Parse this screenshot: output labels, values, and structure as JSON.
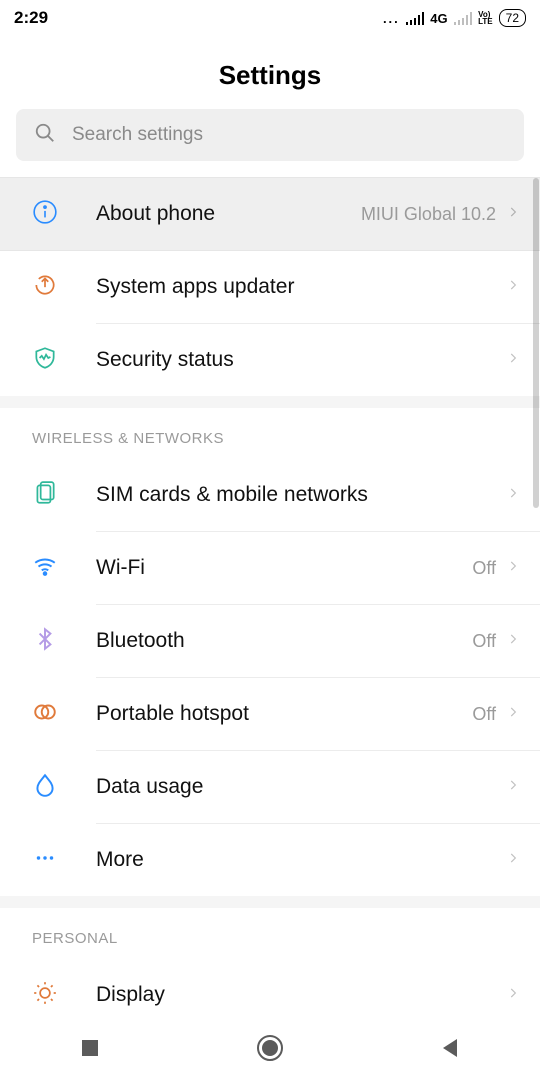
{
  "status": {
    "time": "2:29",
    "net": "4G",
    "volte_top": "Vo)",
    "volte_bot": "LTE",
    "battery": "72"
  },
  "title": "Settings",
  "search": {
    "placeholder": "Search settings"
  },
  "rows": {
    "about": {
      "label": "About phone",
      "value": "MIUI Global 10.2"
    },
    "sysapps": {
      "label": "System apps updater"
    },
    "security": {
      "label": "Security status"
    },
    "sim": {
      "label": "SIM cards & mobile networks"
    },
    "wifi": {
      "label": "Wi-Fi",
      "value": "Off"
    },
    "bluetooth": {
      "label": "Bluetooth",
      "value": "Off"
    },
    "hotspot": {
      "label": "Portable hotspot",
      "value": "Off"
    },
    "datausage": {
      "label": "Data usage"
    },
    "more": {
      "label": "More"
    },
    "display": {
      "label": "Display"
    }
  },
  "sections": {
    "wireless": "WIRELESS & NETWORKS",
    "personal": "PERSONAL"
  }
}
